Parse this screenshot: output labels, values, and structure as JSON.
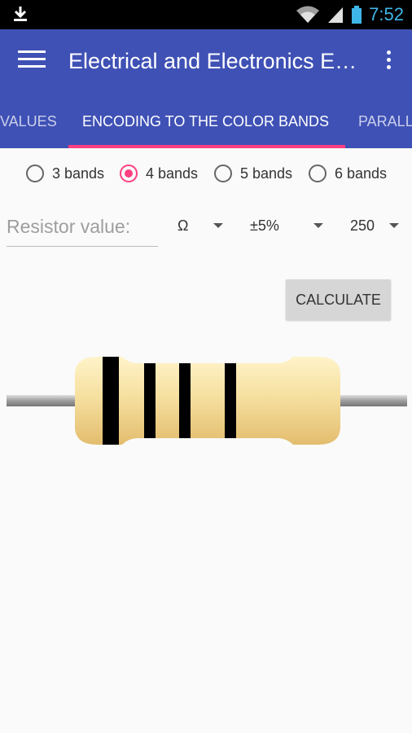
{
  "status_bar": {
    "time": "7:52",
    "icons": [
      "download-icon",
      "wifi-icon",
      "signal-icon",
      "battery-icon"
    ]
  },
  "app_bar": {
    "title": "Electrical and Electronics Engineering"
  },
  "tabs": [
    {
      "label": "VALUES",
      "active": false
    },
    {
      "label": "ENCODING TO THE COLOR BANDS",
      "active": true
    },
    {
      "label": "PARALLEL",
      "active": false
    }
  ],
  "band_options": [
    {
      "label": "3 bands",
      "selected": false
    },
    {
      "label": "4 bands",
      "selected": true
    },
    {
      "label": "5 bands",
      "selected": false
    },
    {
      "label": "6 bands",
      "selected": false
    }
  ],
  "resistor_input": {
    "placeholder": "Resistor value:",
    "value": ""
  },
  "unit_spinner": {
    "value": "Ω"
  },
  "tolerance_spinner": {
    "value": "±5%"
  },
  "power_spinner": {
    "value": "250"
  },
  "calculate_button": {
    "label": "CALCULATE"
  },
  "resistor": {
    "band_colors": [
      "#000000",
      "#000000",
      "#000000",
      "#000000"
    ]
  },
  "colors": {
    "primary": "#3f51b5",
    "accent": "#ff4081"
  }
}
